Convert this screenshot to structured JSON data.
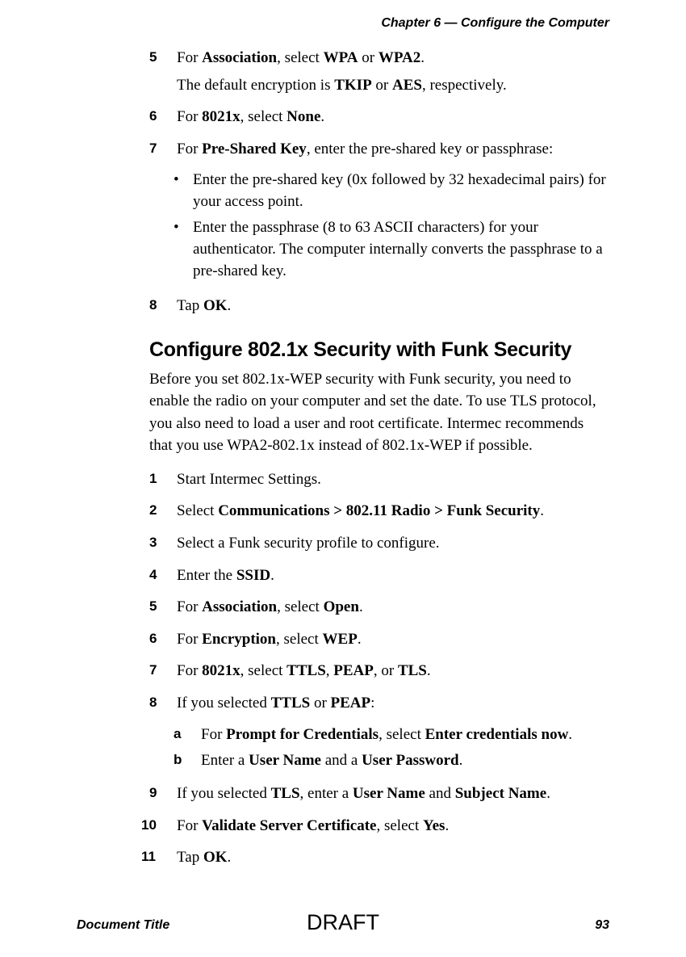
{
  "header": {
    "chapter": "Chapter 6 — Configure the Computer"
  },
  "stepsA": {
    "s5": {
      "num": "5",
      "line1_pre": "For ",
      "line1_b1": "Association",
      "line1_mid": ", select ",
      "line1_b2": "WPA",
      "line1_or": " or ",
      "line1_b3": "WPA2",
      "line1_end": ".",
      "line2_pre": "The default encryption is ",
      "line2_b1": "TKIP",
      "line2_or": " or ",
      "line2_b2": "AES",
      "line2_end": ", respectively."
    },
    "s6": {
      "num": "6",
      "pre": "For ",
      "b1": "8021x",
      "mid": ", select ",
      "b2": "None",
      "end": "."
    },
    "s7": {
      "num": "7",
      "pre": "For ",
      "b1": "Pre-Shared Key",
      "end": ", enter the pre-shared key or passphrase:",
      "bullet1": "Enter the pre-shared key (0x followed by 32 hexadecimal pairs) for your access point.",
      "bullet2": "Enter the passphrase (8 to 63 ASCII characters) for your authenticator. The computer internally converts the passphrase to a pre-shared key."
    },
    "s8": {
      "num": "8",
      "pre": "Tap ",
      "b1": "OK",
      "end": "."
    }
  },
  "section": {
    "heading": "Configure 802.1x Security with Funk Security",
    "intro": "Before you set 802.1x-WEP security with Funk security, you need to enable the radio on your computer and set the date. To use TLS protocol, you also need to load a user and root certificate. Intermec recommends that you use WPA2-802.1x instead of 802.1x-WEP if possible."
  },
  "stepsB": {
    "s1": {
      "num": "1",
      "text": "Start Intermec Settings."
    },
    "s2": {
      "num": "2",
      "pre": "Select ",
      "b1": "Communications > 802.11 Radio > Funk Security",
      "end": "."
    },
    "s3": {
      "num": "3",
      "text": "Select a Funk security profile to configure."
    },
    "s4": {
      "num": "4",
      "pre": "Enter the ",
      "b1": "SSID",
      "end": "."
    },
    "s5": {
      "num": "5",
      "pre": "For ",
      "b1": "Association",
      "mid": ", select ",
      "b2": "Open",
      "end": "."
    },
    "s6": {
      "num": "6",
      "pre": "For ",
      "b1": "Encryption",
      "mid": ", select ",
      "b2": "WEP",
      "end": "."
    },
    "s7": {
      "num": "7",
      "pre": "For ",
      "b1": "8021x",
      "mid": ", select ",
      "b2": "TTLS",
      "c1": ", ",
      "b3": "PEAP",
      "c2": ", or ",
      "b4": "TLS",
      "end": "."
    },
    "s8": {
      "num": "8",
      "pre": "If you selected ",
      "b1": "TTLS",
      "or": " or ",
      "b2": "PEAP",
      "end": ":",
      "a_letter": "a",
      "a_pre": "For ",
      "a_b1": "Prompt for Credentials",
      "a_mid": ", select ",
      "a_b2": "Enter credentials now",
      "a_end": ".",
      "b_letter": "b",
      "b_pre": "Enter a ",
      "b_b1": "User Name",
      "b_mid": " and a ",
      "b_b2": "User Password",
      "b_end": "."
    },
    "s9": {
      "num": "9",
      "pre": "If you selected ",
      "b1": "TLS",
      "mid": ", enter a ",
      "b2": "User Name",
      "and": " and ",
      "b3": "Subject Name",
      "end": "."
    },
    "s10": {
      "num": "10",
      "pre": "For ",
      "b1": "Validate Server Certificate",
      "mid": ", select ",
      "b2": "Yes",
      "end": "."
    },
    "s11": {
      "num": "11",
      "pre": "Tap ",
      "b1": "OK",
      "end": "."
    }
  },
  "footer": {
    "doc_title": "Document Title",
    "draft": "DRAFT",
    "page_num": "93"
  }
}
